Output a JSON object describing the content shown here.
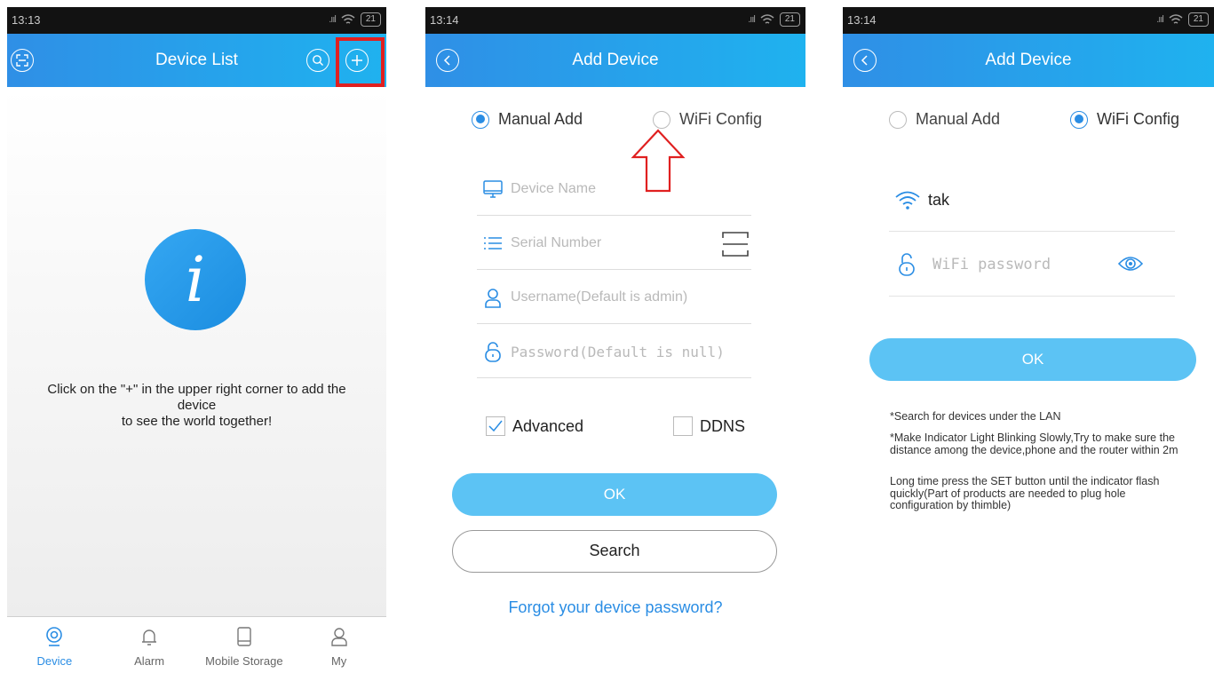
{
  "screen1": {
    "status": {
      "time": "13:13",
      "signal": ".ııl",
      "battery": "21"
    },
    "title": "Device List",
    "empty_message_line1": "Click on the \"+\" in the upper right corner to add the",
    "empty_message_line2": "device",
    "empty_message_line3": "to see the world together!",
    "info_glyph": "i",
    "tabs": [
      {
        "label": "Device",
        "icon": "camera-icon",
        "active": true
      },
      {
        "label": "Alarm",
        "icon": "bell-icon",
        "active": false
      },
      {
        "label": "Mobile Storage",
        "icon": "tablet-icon",
        "active": false
      },
      {
        "label": "My",
        "icon": "user-icon",
        "active": false
      }
    ]
  },
  "screen2": {
    "status": {
      "time": "13:14",
      "signal": ".ııl",
      "battery": "21"
    },
    "title": "Add Device",
    "radio_manual": "Manual Add",
    "radio_wifi": "WiFi Config",
    "selected": "manual",
    "fields": {
      "device_name": "Device Name",
      "serial_number": "Serial Number",
      "username": "Username(Default is admin)",
      "password": "Password(Default is null)"
    },
    "advanced_label": "Advanced",
    "advanced_checked": true,
    "ddns_label": "DDNS",
    "ddns_checked": false,
    "ok_label": "OK",
    "search_label": "Search",
    "forgot_link": "Forgot your device password?"
  },
  "screen3": {
    "status": {
      "time": "13:14",
      "signal": ".ııl",
      "battery": "21"
    },
    "title": "Add Device",
    "radio_manual": "Manual Add",
    "radio_wifi": "WiFi Config",
    "selected": "wifi",
    "ssid": "tak",
    "password_placeholder": "WiFi password",
    "ok_label": "OK",
    "note1": "*Search for devices under the LAN",
    "note2": "*Make Indicator Light Blinking Slowly,Try to make sure the distance among the device,phone and the router within 2m",
    "note3": "Long time press the SET button until the indicator flash quickly(Part of products are needed to plug hole configuration by thimble)"
  },
  "colors": {
    "accent": "#2a8de4",
    "header_start": "#2f8fe6",
    "header_end": "#1fb2ef",
    "button": "#5cc3f4",
    "highlight_red": "#e02020"
  }
}
